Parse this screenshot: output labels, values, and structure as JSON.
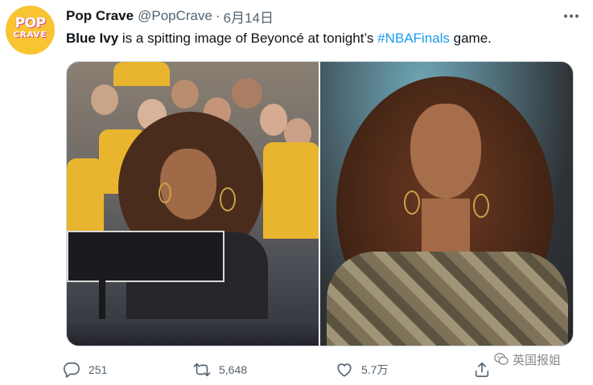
{
  "account": {
    "avatar_text_line1": "POP",
    "avatar_text_line2": "CRAVE",
    "display_name": "Pop Crave",
    "handle": "@PopCrave",
    "separator": "·",
    "date": "6月14日"
  },
  "tweet": {
    "mention": "Blue Ivy",
    "text_middle": " is a spitting image of Beyoncé at tonight’s ",
    "hashtag": "#NBAFinals",
    "text_end": " game."
  },
  "media": {
    "left_photo": "blue-ivy-courtside-photo",
    "right_photo": "beyonce-photo"
  },
  "actions": {
    "reply_count": "251",
    "retweet_count": "5,648",
    "like_count": "5.7万"
  },
  "watermark": {
    "text": "英国报姐"
  },
  "colors": {
    "link": "#1d9bf0",
    "secondary_text": "#536471",
    "avatar_bg": "#f9c431"
  }
}
